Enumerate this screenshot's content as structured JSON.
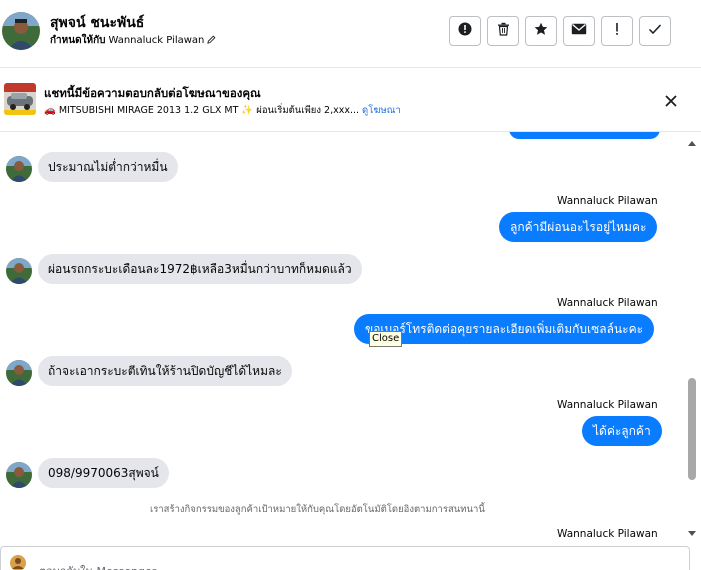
{
  "header": {
    "name": "สุพจน์ ชนะพันธ์",
    "assigned_label": "กำหนดให้กับ",
    "assigned_to": "Wannaluck Pilawan",
    "buttons": [
      {
        "icon": "alert-circle-icon"
      },
      {
        "icon": "trash-icon"
      },
      {
        "icon": "star-icon"
      },
      {
        "icon": "envelope-icon"
      },
      {
        "icon": "exclamation-icon"
      },
      {
        "icon": "check-icon"
      }
    ]
  },
  "ad": {
    "title": "แชทนี้มีข้อความตอบกลับต่อโฆษณาของคุณ",
    "description": "🚗 MITSUBISHI MIRAGE 2013 1.2 GLX MT ✨ ผ่อนเริ่มต้นเพียง 2,xxx... ",
    "link": "ดูโฆษณา"
  },
  "messages": [
    {
      "type": "in",
      "text": "ประมาณไม่ต่ำกว่าหมื่น"
    },
    {
      "type": "sender",
      "text": "Wannaluck Pilawan"
    },
    {
      "type": "out",
      "text": "ลูกค้ามีผ่อนอะไรอยู่ไหมคะ"
    },
    {
      "type": "in",
      "text": "ผ่อนรถกระบะเดือนละ1972฿เหลือ3หมื่นกว่าบาทก็หมดแล้ว"
    },
    {
      "type": "sender",
      "text": "Wannaluck Pilawan"
    },
    {
      "type": "out",
      "text": "ขอเบอร์โทรติดต่อคุยรายละเอียดเพิ่มเติมกับเซลล์นะคะ"
    },
    {
      "type": "in",
      "text": "ถ้าจะเอากระบะตีเทินให้ร้านปิดบัญชีได้ไหมละ"
    },
    {
      "type": "sender",
      "text": "Wannaluck Pilawan"
    },
    {
      "type": "out",
      "text": "ได้ค่ะลูกค้า"
    },
    {
      "type": "in",
      "text": "098/9970063สุพจน์"
    },
    {
      "type": "notice",
      "text": "เราสร้างกิจกรรมของลูกค้าเป้าหมายให้กับคุณโดยอัตโนมัติโดยอิงตามการสนทนานี้"
    },
    {
      "type": "sender",
      "text": "Wannaluck Pilawan"
    }
  ],
  "tooltip": "Close",
  "composer": {
    "placeholder": "ตอบกลับใน Messenger"
  },
  "colors": {
    "outgoing_bubble": "#0a7cff",
    "incoming_bubble": "#e4e6eb",
    "link": "#216fdb"
  }
}
